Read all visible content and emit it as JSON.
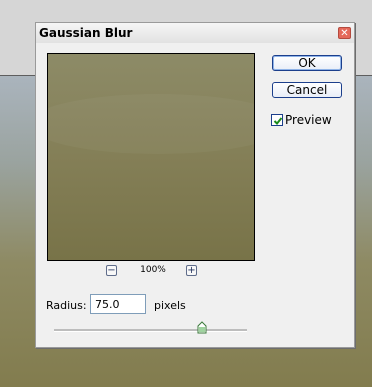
{
  "dialog": {
    "title": "Gaussian Blur",
    "close_icon": "close-icon"
  },
  "buttons": {
    "ok": "OK",
    "cancel": "Cancel"
  },
  "preview_checkbox": {
    "label": "Preview",
    "checked": true
  },
  "zoom": {
    "level": "100%",
    "minus_icon": "minus-icon",
    "plus_icon": "plus-icon"
  },
  "radius": {
    "label": "Radius:",
    "value": "75.0",
    "unit": "pixels",
    "slider_position": 0.78
  },
  "colors": {
    "accent": "#1c3f8c",
    "close": "#e5695a",
    "preview": "#847f57"
  }
}
